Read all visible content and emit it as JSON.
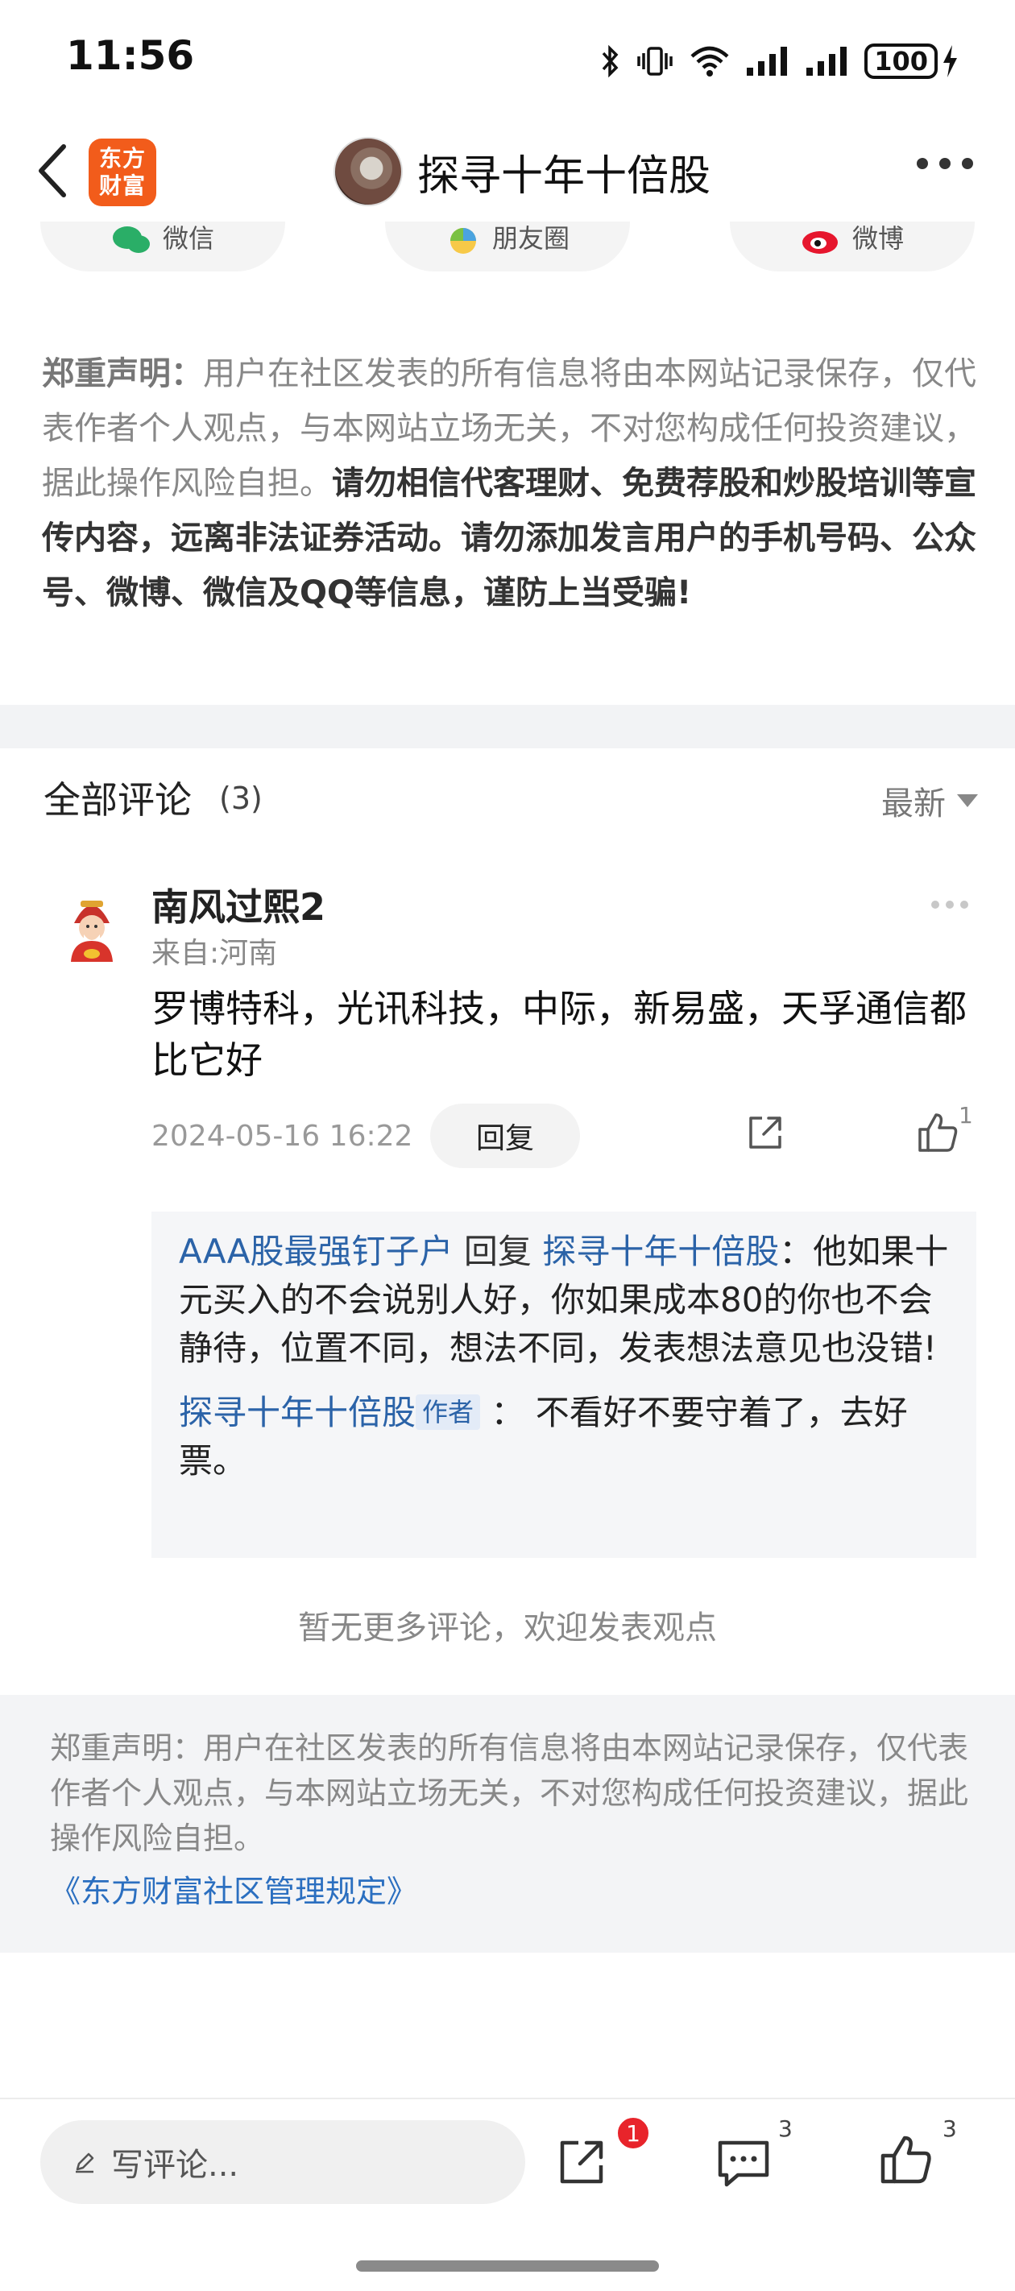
{
  "status_bar": {
    "time": "11:56",
    "battery": "100",
    "icons": [
      "bluetooth-icon",
      "vibrate-icon",
      "wifi-icon",
      "signal-icon",
      "signal-icon",
      "battery-icon",
      "charging-icon"
    ]
  },
  "nav": {
    "app_logo_line1": "东方",
    "app_logo_line2": "财富",
    "title": "探寻十年十倍股",
    "brand_color": "#f25c1b"
  },
  "share_options": [
    "微信",
    "朋友圈",
    "微博"
  ],
  "disclaimer_top": {
    "label": "郑重声明：",
    "text": "用户在社区发表的所有信息将由本网站记录保存，仅代表作者个人观点，与本网站立场无关，不对您构成任何投资建议，据此操作风险自担。",
    "strong": "请勿相信代客理财、免费荐股和炒股培训等宣传内容，远离非法证券活动。请勿添加发言用户的手机号码、公众号、微博、微信及QQ等信息，谨防上当受骗!"
  },
  "comments": {
    "title": "全部评论",
    "count": "(3)",
    "sort": "最新",
    "no_more": "暂无更多评论，欢迎发表观点",
    "items": [
      {
        "user": "南风过熙2",
        "location": "来自:河南",
        "text": "罗博特科，光讯科技，中际，新易盛，天孚通信都比它好",
        "time": "2024-05-16 16:22",
        "reply_label": "回复",
        "likes": "1",
        "replies": [
          {
            "author": "AAA股最强钉子户",
            "action": "回复",
            "target": "探寻十年十倍股",
            "text": "：他如果十元买入的不会说别人好，你如果成本80的你也不会静待，位置不同，想法不同，发表想法意见也没错!"
          },
          {
            "author": "探寻十年十倍股",
            "tag": "作者",
            "text": "： 不看好不要守着了，去好票。"
          }
        ]
      }
    ]
  },
  "disclaimer_bottom": {
    "text": "郑重声明：用户在社区发表的所有信息将由本网站记录保存，仅代表作者个人观点，与本网站立场无关，不对您构成任何投资建议，据此操作风险自担。",
    "link": "《东方财富社区管理规定》"
  },
  "bottom_bar": {
    "placeholder": "写评论...",
    "share_badge": "1",
    "comments_count": "3",
    "likes_count": "3"
  }
}
